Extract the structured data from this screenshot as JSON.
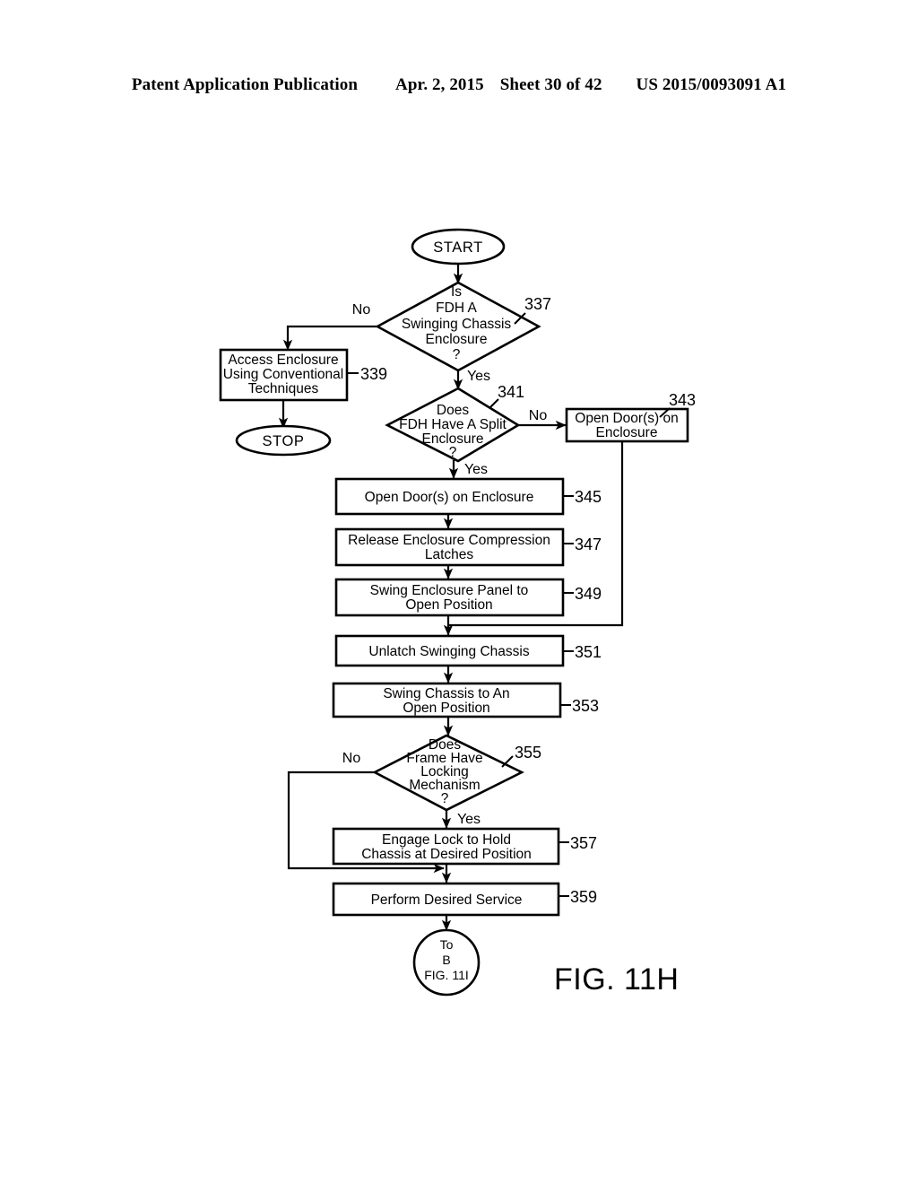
{
  "header": {
    "publication": "Patent Application Publication",
    "date": "Apr. 2, 2015",
    "sheet": "Sheet 30 of 42",
    "number": "US 2015/0093091 A1"
  },
  "figure": {
    "label": "FIG. 11H",
    "type": "flowchart"
  },
  "nodes": {
    "start": {
      "label": "START",
      "shape": "terminator"
    },
    "stop": {
      "label": "STOP",
      "shape": "terminator"
    },
    "d337": {
      "ref": "337",
      "shape": "decision",
      "lines": [
        "Is",
        "FDH A",
        "Swinging Chassis",
        "Enclosure",
        "?"
      ],
      "yes_label": "Yes",
      "no_label": "No"
    },
    "b339": {
      "ref": "339",
      "shape": "process",
      "lines": [
        "Access Enclosure",
        "Using Conventional",
        "Techniques"
      ]
    },
    "d341": {
      "ref": "341",
      "shape": "decision",
      "lines": [
        "Does",
        "FDH Have A Split",
        "Enclosure",
        "?"
      ],
      "yes_label": "Yes",
      "no_label": "No"
    },
    "b343": {
      "ref": "343",
      "shape": "process",
      "lines": [
        "Open Door(s) on",
        "Enclosure"
      ]
    },
    "b345": {
      "ref": "345",
      "shape": "process",
      "lines": [
        "Open Door(s) on Enclosure"
      ]
    },
    "b347": {
      "ref": "347",
      "shape": "process",
      "lines": [
        "Release Enclosure Compression",
        "Latches"
      ]
    },
    "b349": {
      "ref": "349",
      "shape": "process",
      "lines": [
        "Swing Enclosure Panel to",
        "Open Position"
      ]
    },
    "b351": {
      "ref": "351",
      "shape": "process",
      "lines": [
        "Unlatch Swinging Chassis"
      ]
    },
    "b353": {
      "ref": "353",
      "shape": "process",
      "lines": [
        "Swing Chassis to An",
        "Open Position"
      ]
    },
    "d355": {
      "ref": "355",
      "shape": "decision",
      "lines": [
        "Does",
        "Frame Have",
        "Locking",
        "Mechanism",
        "?"
      ],
      "yes_label": "Yes",
      "no_label": "No"
    },
    "b357": {
      "ref": "357",
      "shape": "process",
      "lines": [
        "Engage Lock to Hold",
        "Chassis at Desired Position"
      ]
    },
    "b359": {
      "ref": "359",
      "shape": "process",
      "lines": [
        "Perform Desired Service"
      ]
    },
    "connector_b": {
      "shape": "off-page-connector",
      "lines": [
        "To",
        "B",
        "FIG. 11I"
      ]
    }
  },
  "chart_data": {
    "type": "diagram",
    "title": "FIG. 11H",
    "diagram_kind": "flowchart",
    "steps": [
      {
        "id": "start",
        "ref": "",
        "kind": "terminator",
        "text": "START"
      },
      {
        "id": "337",
        "ref": "337",
        "kind": "decision",
        "text": "Is FDH A Swinging Chassis Enclosure ?"
      },
      {
        "id": "339",
        "ref": "339",
        "kind": "process",
        "text": "Access Enclosure Using Conventional Techniques"
      },
      {
        "id": "stop",
        "ref": "",
        "kind": "terminator",
        "text": "STOP"
      },
      {
        "id": "341",
        "ref": "341",
        "kind": "decision",
        "text": "Does FDH Have A Split Enclosure ?"
      },
      {
        "id": "343",
        "ref": "343",
        "kind": "process",
        "text": "Open Door(s) on Enclosure"
      },
      {
        "id": "345",
        "ref": "345",
        "kind": "process",
        "text": "Open Door(s) on Enclosure"
      },
      {
        "id": "347",
        "ref": "347",
        "kind": "process",
        "text": "Release Enclosure Compression Latches"
      },
      {
        "id": "349",
        "ref": "349",
        "kind": "process",
        "text": "Swing Enclosure Panel to Open Position"
      },
      {
        "id": "351",
        "ref": "351",
        "kind": "process",
        "text": "Unlatch Swinging Chassis"
      },
      {
        "id": "353",
        "ref": "353",
        "kind": "process",
        "text": "Swing Chassis to An Open Position"
      },
      {
        "id": "355",
        "ref": "355",
        "kind": "decision",
        "text": "Does Frame Have Locking Mechanism ?"
      },
      {
        "id": "357",
        "ref": "357",
        "kind": "process",
        "text": "Engage Lock to Hold Chassis at Desired Position"
      },
      {
        "id": "359",
        "ref": "359",
        "kind": "process",
        "text": "Perform Desired Service"
      },
      {
        "id": "connB",
        "ref": "",
        "kind": "off-page-connector",
        "text": "To B FIG. 11I"
      }
    ],
    "edges": [
      {
        "from": "start",
        "to": "337",
        "label": ""
      },
      {
        "from": "337",
        "to": "339",
        "label": "No"
      },
      {
        "from": "339",
        "to": "stop",
        "label": ""
      },
      {
        "from": "337",
        "to": "341",
        "label": "Yes"
      },
      {
        "from": "341",
        "to": "343",
        "label": "No"
      },
      {
        "from": "341",
        "to": "345",
        "label": "Yes"
      },
      {
        "from": "345",
        "to": "347",
        "label": ""
      },
      {
        "from": "347",
        "to": "349",
        "label": ""
      },
      {
        "from": "349",
        "to": "351",
        "label": ""
      },
      {
        "from": "343",
        "to": "351",
        "label": ""
      },
      {
        "from": "351",
        "to": "353",
        "label": ""
      },
      {
        "from": "353",
        "to": "355",
        "label": ""
      },
      {
        "from": "355",
        "to": "357",
        "label": "Yes"
      },
      {
        "from": "355",
        "to": "359",
        "label": "No"
      },
      {
        "from": "357",
        "to": "359",
        "label": ""
      },
      {
        "from": "359",
        "to": "connB",
        "label": ""
      }
    ]
  }
}
